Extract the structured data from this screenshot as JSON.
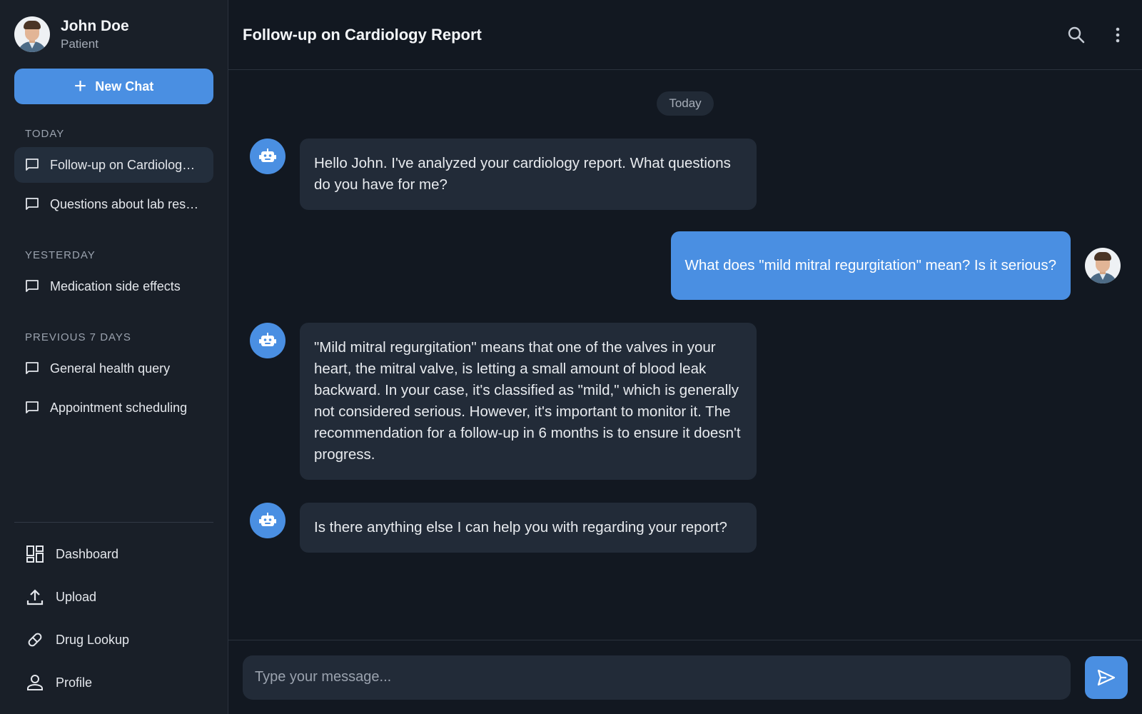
{
  "user": {
    "name": "John Doe",
    "role": "Patient"
  },
  "sidebar": {
    "new_chat_label": "New Chat",
    "sections": [
      {
        "title": "TODAY",
        "items": [
          "Follow-up on Cardiology Report",
          "Questions about lab results"
        ]
      },
      {
        "title": "YESTERDAY",
        "items": [
          "Medication side effects"
        ]
      },
      {
        "title": "PREVIOUS 7 DAYS",
        "items": [
          "General health query",
          "Appointment scheduling"
        ]
      }
    ],
    "nav": [
      "Dashboard",
      "Upload",
      "Drug Lookup",
      "Profile"
    ]
  },
  "header": {
    "title": "Follow-up on Cardiology Report",
    "icons": [
      "search-icon",
      "more-vertical-icon"
    ]
  },
  "chat": {
    "date_label": "Today",
    "messages": [
      {
        "role": "assistant",
        "text": "Hello John. I've analyzed your cardiology report. What questions do you have for me?"
      },
      {
        "role": "user",
        "text": "What does \"mild mitral regurgitation\" mean? Is it serious?"
      },
      {
        "role": "assistant",
        "text": "\"Mild mitral regurgitation\" means that one of the valves in your heart, the mitral valve, is letting a small amount of blood leak backward. In your case, it's classified as \"mild,\" which is generally not considered serious. However, it's important to monitor it. The recommendation for a follow-up in 6 months is to ensure it doesn't progress."
      },
      {
        "role": "assistant",
        "text": "Is there anything else I can help you with regarding your report?"
      }
    ]
  },
  "composer": {
    "placeholder": "Type your message..."
  },
  "colors": {
    "accent": "#4a8fe2",
    "background": "#121821",
    "sidebar": "#191f28",
    "bubble": "#222b38"
  }
}
